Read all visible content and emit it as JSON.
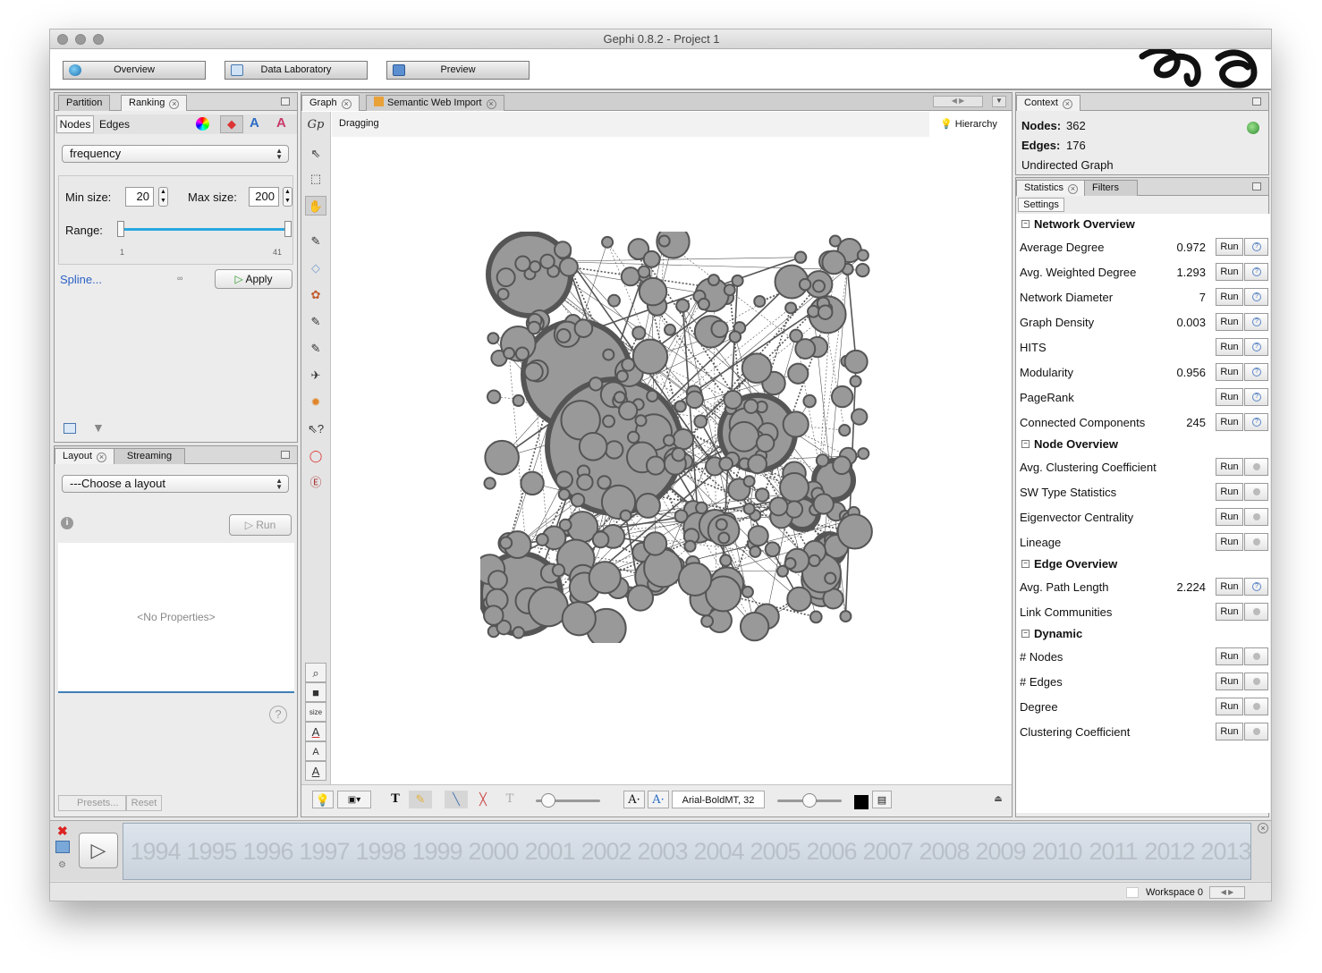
{
  "window": {
    "title": "Gephi 0.8.2 - Project 1"
  },
  "modes": {
    "overview": "Overview",
    "data_lab": "Data Laboratory",
    "preview": "Preview"
  },
  "ranking": {
    "tabs": {
      "partition": "Partition",
      "ranking": "Ranking"
    },
    "subtabs": {
      "nodes": "Nodes",
      "edges": "Edges"
    },
    "attribute": "frequency",
    "min_label": "Min size:",
    "min_value": "20",
    "max_label": "Max size:",
    "max_value": "200",
    "range_label": "Range:",
    "range_min": "1",
    "range_max": "41",
    "spline": "Spline...",
    "apply": "Apply"
  },
  "layout": {
    "tabs": {
      "layout": "Layout",
      "streaming": "Streaming"
    },
    "choose": "---Choose a layout",
    "run": "Run",
    "no_props": "<No Properties>",
    "presets": "Presets...",
    "reset": "Reset"
  },
  "graph": {
    "tabs": {
      "graph": "Graph",
      "semantic": "Semantic Web Import"
    },
    "mode": "Dragging",
    "hierarchy": "Hierarchy",
    "size_label": "size",
    "font": "Arial-BoldMT, 32"
  },
  "context": {
    "tab": "Context",
    "nodes_label": "Nodes:",
    "nodes_value": "362",
    "edges_label": "Edges:",
    "edges_value": "176",
    "graph_type": "Undirected Graph"
  },
  "statistics": {
    "tabs": {
      "statistics": "Statistics",
      "filters": "Filters"
    },
    "settings": "Settings",
    "run_label": "Run",
    "sections": [
      {
        "title": "Network Overview",
        "items": [
          {
            "label": "Average Degree",
            "value": "0.972"
          },
          {
            "label": "Avg. Weighted Degree",
            "value": "1.293"
          },
          {
            "label": "Network Diameter",
            "value": "7"
          },
          {
            "label": "Graph Density",
            "value": "0.003"
          },
          {
            "label": "HITS",
            "value": ""
          },
          {
            "label": "Modularity",
            "value": "0.956"
          },
          {
            "label": "PageRank",
            "value": ""
          },
          {
            "label": "Connected Components",
            "value": "245"
          }
        ]
      },
      {
        "title": "Node Overview",
        "items": [
          {
            "label": "Avg. Clustering Coefficient",
            "value": ""
          },
          {
            "label": "SW Type Statistics",
            "value": ""
          },
          {
            "label": "Eigenvector Centrality",
            "value": ""
          },
          {
            "label": "Lineage",
            "value": ""
          }
        ]
      },
      {
        "title": "Edge Overview",
        "items": [
          {
            "label": "Avg. Path Length",
            "value": "2.224"
          },
          {
            "label": "Link Communities",
            "value": ""
          }
        ]
      },
      {
        "title": "Dynamic",
        "items": [
          {
            "label": "# Nodes",
            "value": ""
          },
          {
            "label": "# Edges",
            "value": ""
          },
          {
            "label": "Degree",
            "value": ""
          },
          {
            "label": "Clustering Coefficient",
            "value": ""
          }
        ]
      }
    ]
  },
  "timeline": {
    "years": [
      "1994",
      "1995",
      "1996",
      "1997",
      "1998",
      "1999",
      "2000",
      "2001",
      "2002",
      "2003",
      "2004",
      "2005",
      "2006",
      "2007",
      "2008",
      "2009",
      "2010",
      "2011",
      "2012",
      "2013"
    ]
  },
  "status": {
    "workspace": "Workspace 0"
  }
}
